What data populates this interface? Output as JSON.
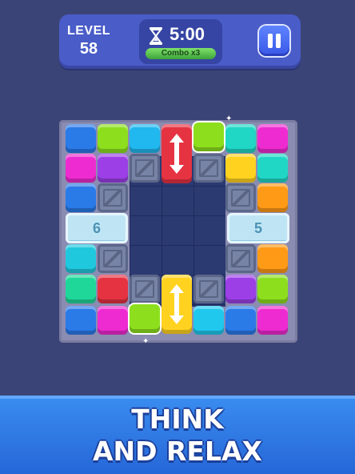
{
  "hud": {
    "level_label": "LEVEL",
    "level_value": "58",
    "timer": "5:00",
    "combo": "Combo x3",
    "icons": {
      "timer": "hourglass-icon",
      "pause": "pause-icon"
    }
  },
  "board": {
    "left_ice_counter": "6",
    "right_ice_counter": "5"
  },
  "banner": {
    "line1": "THINK",
    "line2": "AND RELAX"
  },
  "colors": {
    "background": "#3b4476",
    "hud": "#4a5cc8",
    "banner": "#2f78e6",
    "red": "#e53342",
    "yellow": "#ffd21f",
    "lime": "#8ddf1e",
    "magenta": "#ee2bd0",
    "cyan": "#20d7dd",
    "blue": "#2a7ae8",
    "orange": "#ff9a16",
    "purple": "#9c3fe6"
  }
}
